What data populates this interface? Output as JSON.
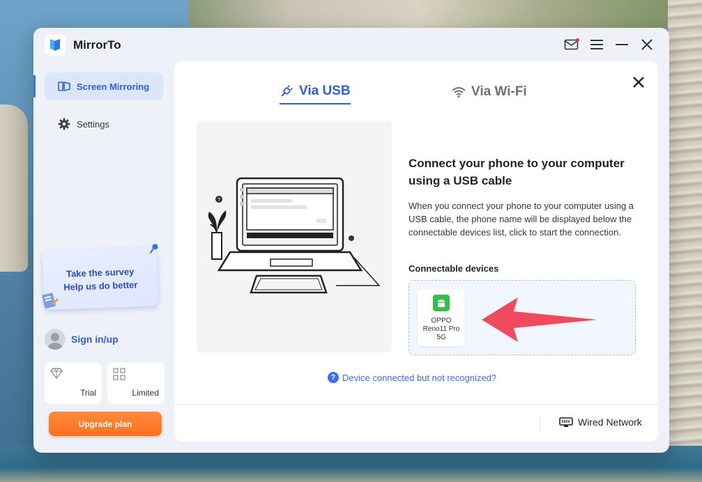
{
  "app": {
    "title": "MirrorTo",
    "brand_color": "#2f5fd6",
    "accent_orange": "#fa6f1c"
  },
  "titlebar": {
    "icons": [
      "mail-notification-icon",
      "menu-icon",
      "minimize-icon",
      "close-icon"
    ]
  },
  "sidebar": {
    "items": [
      {
        "label": "Screen Mirroring",
        "icon": "screen-mirroring-icon",
        "active": true
      },
      {
        "label": "Settings",
        "icon": "gear-icon",
        "active": false
      }
    ],
    "survey": {
      "line1": "Take the survey",
      "line2": "Help us do better"
    },
    "signin_label": "Sign in/up",
    "plans": [
      {
        "label": "Trial",
        "icon": "diamond-icon"
      },
      {
        "label": "Limited",
        "icon": "grid-icon"
      }
    ],
    "upgrade_label": "Upgrade plan"
  },
  "main": {
    "tabs": [
      {
        "label": "Via USB",
        "icon": "usb-plug-icon",
        "active": true
      },
      {
        "label": "Via Wi-Fi",
        "icon": "wifi-icon",
        "active": false
      }
    ],
    "heading": "Connect your phone to your computer using a USB cable",
    "description": "When you connect your phone to your computer using a USB cable, the phone name will be displayed below the connectable devices list, click to start the connection.",
    "devices_title": "Connectable devices",
    "devices": [
      {
        "name": "OPPO Reno11 Pro 5G",
        "icon": "android-icon"
      }
    ],
    "help_link": "Device connected but not recognized?",
    "footer": {
      "network_label": "Wired Network",
      "network_icon": "ethernet-icon"
    }
  }
}
